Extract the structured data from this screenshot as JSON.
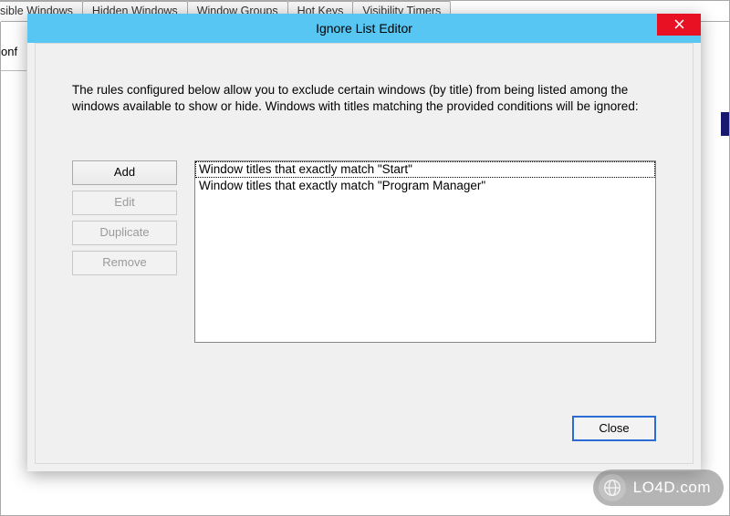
{
  "background": {
    "tabs": [
      {
        "label": "sible Windows"
      },
      {
        "label": "Hidden Windows"
      },
      {
        "label": "Window Groups"
      },
      {
        "label": "Hot Keys"
      },
      {
        "label": "Visibility Timers"
      }
    ],
    "onf_label": "onf"
  },
  "dialog": {
    "title": "Ignore List Editor",
    "intro": "The rules configured below allow you to exclude certain windows (by title) from being listed among the windows available to show or hide.  Windows with titles matching the provided conditions will be ignored:",
    "buttons": {
      "add": {
        "label": "Add",
        "enabled": true
      },
      "edit": {
        "label": "Edit",
        "enabled": false
      },
      "duplicate": {
        "label": "Duplicate",
        "enabled": false
      },
      "remove": {
        "label": "Remove",
        "enabled": false
      }
    },
    "rules": [
      "Window titles that exactly match \"Start\"",
      "Window titles that exactly match \"Program Manager\""
    ],
    "selected_rule_index": 0,
    "close_label": "Close"
  },
  "watermark": {
    "text": "LO4D.com"
  },
  "colors": {
    "titlebar": "#58c6f2",
    "close_btn": "#e81123",
    "focus_ring": "#2a6cd3",
    "bg_accent": "#191970"
  }
}
